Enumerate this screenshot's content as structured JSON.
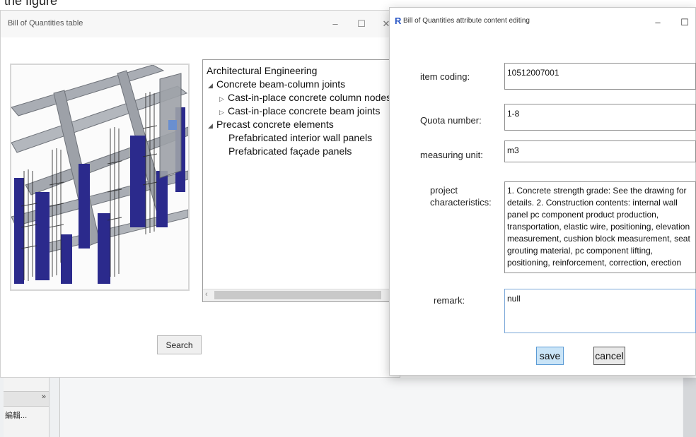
{
  "top_strip": {
    "text": "the figure"
  },
  "left_window": {
    "title": "Bill of Quantities table",
    "minimize": "–",
    "maximize": "☐",
    "close": "✕",
    "search_label": "Search",
    "tree": {
      "root": "Architectural Engineering",
      "children": [
        {
          "label": "Concrete beam-column joints",
          "arrow": "◢",
          "children": [
            {
              "label": "Cast-in-place concrete column nodes",
              "arrow": "▷"
            },
            {
              "label": "Cast-in-place concrete beam joints",
              "arrow": "▷"
            }
          ]
        },
        {
          "label": "Precast concrete elements",
          "arrow": "◢",
          "children": [
            {
              "label": "Prefabricated interior wall panels"
            },
            {
              "label": "Prefabricated façade panels"
            }
          ]
        }
      ],
      "scroll_left": "‹",
      "scroll_right": "›"
    }
  },
  "right_window": {
    "app_icon": "R",
    "title": "Bill of Quantities attribute content editing",
    "minimize": "–",
    "maximize": "☐",
    "fields": {
      "item_coding": {
        "label": "item coding:",
        "value": "10512007001"
      },
      "quota_number": {
        "label": "Quota number:",
        "value": "1-8"
      },
      "measuring_unit": {
        "label": "measuring unit:",
        "value": "m3"
      },
      "project_characteristics": {
        "label_line1": "project",
        "label_line2": "characteristics:",
        "value": "1. Concrete strength grade: See the drawing for details. 2. Construction contents: internal wall panel pc component product production, transportation, elastic wire, positioning, elevation measurement, cushion block measurement, seat grouting material, pc component lifting, positioning, reinforcement, correction, erection"
      },
      "remark": {
        "label": "remark:",
        "value": "null"
      }
    },
    "save_label": "save",
    "cancel_label": "cancel"
  },
  "host_app": {
    "panel_chevron": "»",
    "panel_item": "編輯..."
  },
  "colors": {
    "beam_grey": "#a9adb4",
    "column_blue": "#2b2a8c",
    "rebar_dark": "#2a2a2a",
    "save_bg": "#c9e4f7",
    "remark_border": "#7aa7d8"
  }
}
